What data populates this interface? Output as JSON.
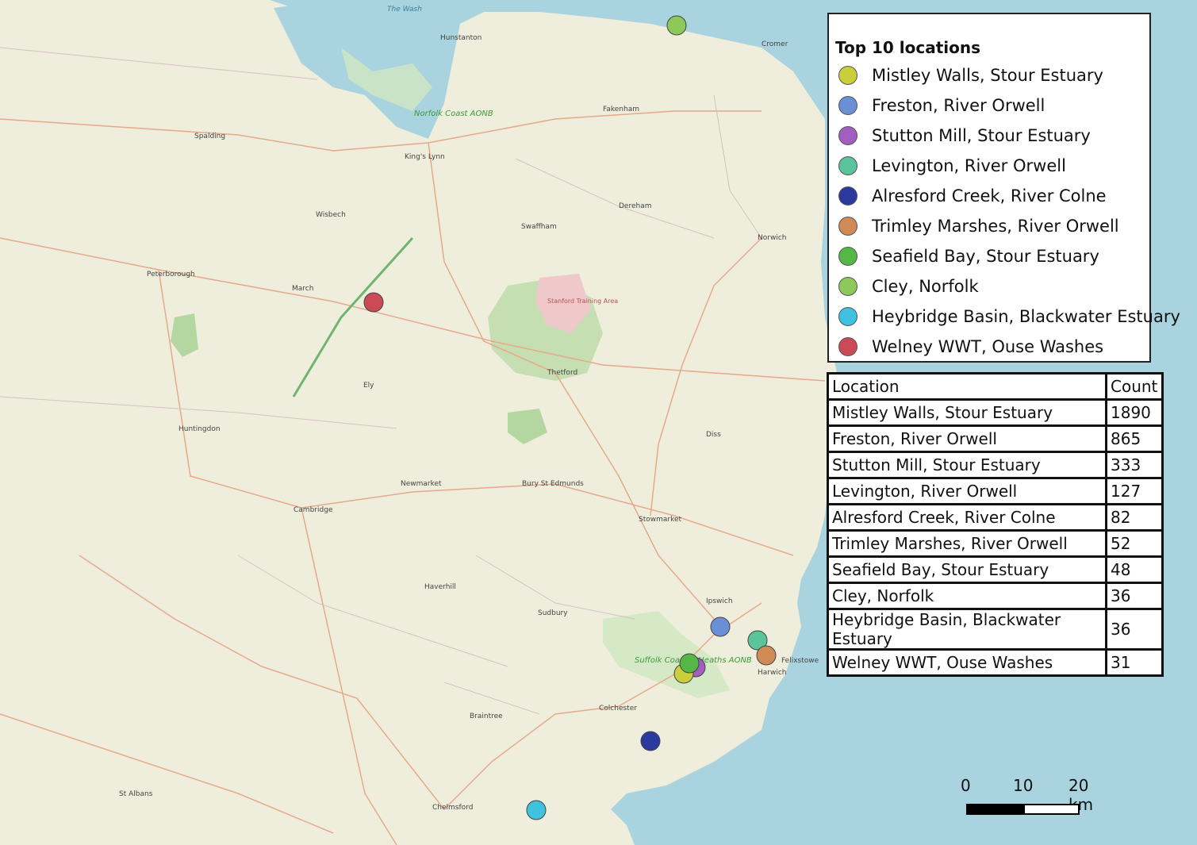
{
  "legend": {
    "title": "Top 10 locations",
    "items": [
      {
        "label": "Mistley Walls, Stour Estuary",
        "color": "#c8cf3a"
      },
      {
        "label": "Freston, River Orwell",
        "color": "#6b8fd6"
      },
      {
        "label": "Stutton Mill, Stour Estuary",
        "color": "#a25fbf"
      },
      {
        "label": "Levington, River Orwell",
        "color": "#5bc49a"
      },
      {
        "label": "Alresford Creek, River Colne",
        "color": "#2b3a9e"
      },
      {
        "label": "Trimley Marshes, River Orwell",
        "color": "#d08a56"
      },
      {
        "label": "Seafield Bay, Stour Estuary",
        "color": "#55b846"
      },
      {
        "label": "Cley, Norfolk",
        "color": "#8cc85a"
      },
      {
        "label": "Heybridge Basin, Blackwater Estuary",
        "color": "#3fc1e0"
      },
      {
        "label": "Welney WWT, Ouse Washes",
        "color": "#cc4a55"
      }
    ]
  },
  "table": {
    "headers": [
      "Location",
      "Count"
    ],
    "rows": [
      [
        "Mistley Walls, Stour Estuary",
        "1890"
      ],
      [
        "Freston, River Orwell",
        "865"
      ],
      [
        "Stutton Mill, Stour Estuary",
        "333"
      ],
      [
        "Levington, River Orwell",
        "127"
      ],
      [
        "Alresford Creek, River Colne",
        "82"
      ],
      [
        "Trimley Marshes, River Orwell",
        "52"
      ],
      [
        "Seafield Bay, Stour Estuary",
        "48"
      ],
      [
        "Cley, Norfolk",
        "36"
      ],
      [
        "Heybridge Basin, Blackwater Estuary",
        "36"
      ],
      [
        "Welney WWT, Ouse Washes",
        "31"
      ]
    ]
  },
  "scale": {
    "ticks": [
      "0",
      "10",
      "20 km"
    ]
  },
  "map_labels": {
    "peterborough": "Peterborough",
    "cambridge": "Cambridge",
    "kings_lynn": "King's Lynn",
    "norwich": "Norwich",
    "colchester": "Colchester",
    "chelmsford": "Chelmsford",
    "ely": "Ely",
    "st_albans": "St Albans",
    "bury": "Bury St Edmunds",
    "ipswich": "Ipswich",
    "thetford": "Thetford",
    "norfolk_coast": "Norfolk Coast AONB",
    "suffolk_coast": "Suffolk Coast & Heaths AONB",
    "the_wash": "The Wash",
    "stanford": "Stanford Training Area",
    "newmarket": "Newmarket",
    "harwich": "Harwich",
    "felixstowe": "Felixstowe",
    "hunstanton": "Hunstanton",
    "cromer": "Cromer",
    "fakenham": "Fakenham",
    "dereham": "Dereham",
    "swaffham": "Swaffham",
    "huntingdon": "Huntingdon",
    "sudbury": "Sudbury",
    "haverhill": "Haverhill",
    "braintree": "Braintree",
    "stowmarket": "Stowmarket",
    "diss": "Diss",
    "march": "March",
    "wisbech": "Wisbech",
    "spalding": "Spalding"
  }
}
